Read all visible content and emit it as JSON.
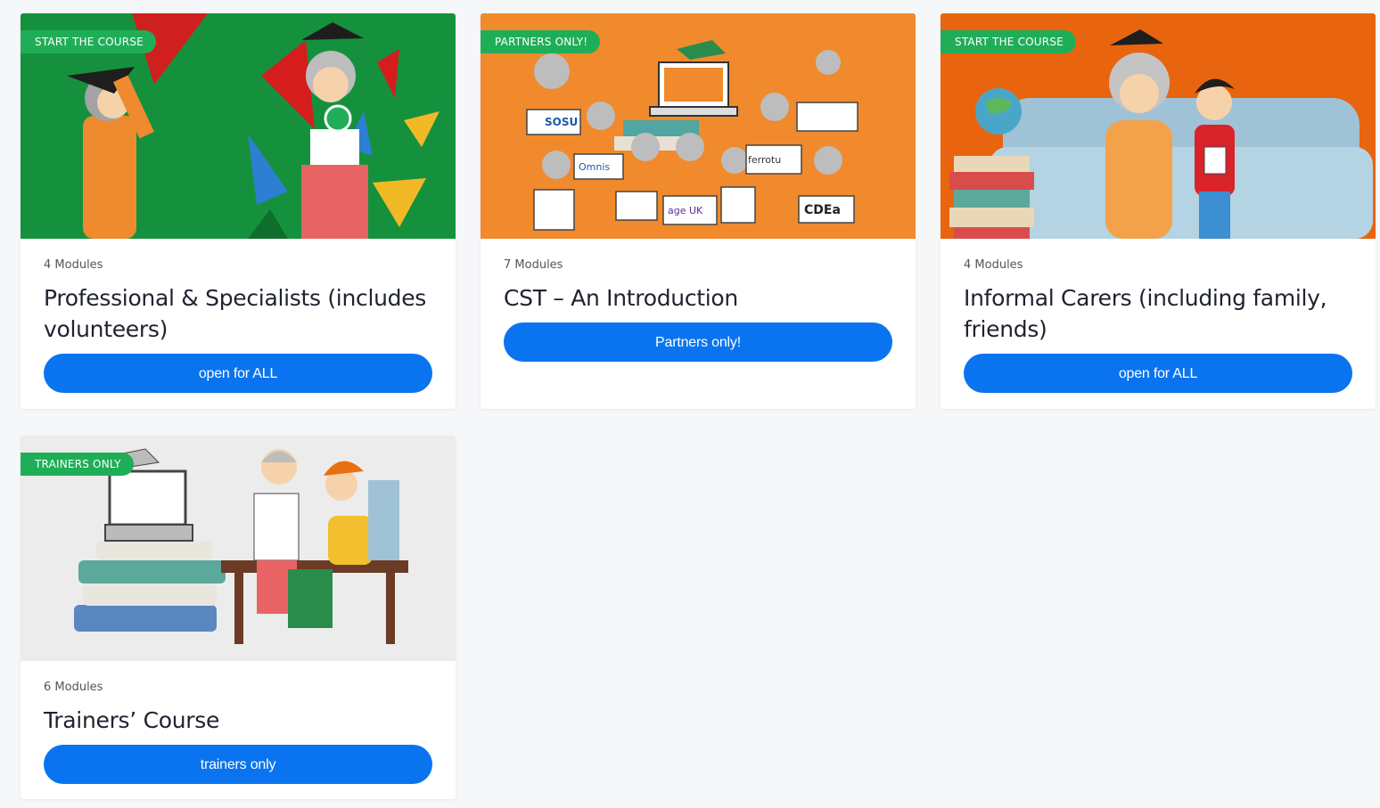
{
  "courses": [
    {
      "badge": "START THE COURSE",
      "modules": "4 Modules",
      "title": "Professional & Specialists (includes volunteers)",
      "button": "open for ALL",
      "image_theme": "green",
      "colors": {
        "bg": "#15913d"
      }
    },
    {
      "badge": "PARTNERS ONLY!",
      "modules": "7 Modules",
      "title": "CST – An  Introduction",
      "button": "Partners only!",
      "image_theme": "orange",
      "colors": {
        "bg": "#f08a2c"
      },
      "image_signs": [
        "SOSU",
        "Omnis",
        "ferrotu",
        "CDEa",
        "age UK"
      ]
    },
    {
      "badge": "START THE COURSE",
      "modules": "4 Modules",
      "title": "Informal Carers (including family, friends)",
      "button": "open for ALL",
      "image_theme": "dark-orange",
      "colors": {
        "bg": "#e9640e"
      }
    },
    {
      "badge": "TRAINERS ONLY",
      "modules": "6 Modules",
      "title": "Trainers’ Course",
      "button": "trainers only",
      "image_theme": "grey",
      "colors": {
        "bg": "#ececec"
      }
    }
  ],
  "colors": {
    "badge": "#1fae57",
    "button": "#0a74f0",
    "page_bg": "#f6f7f9"
  }
}
